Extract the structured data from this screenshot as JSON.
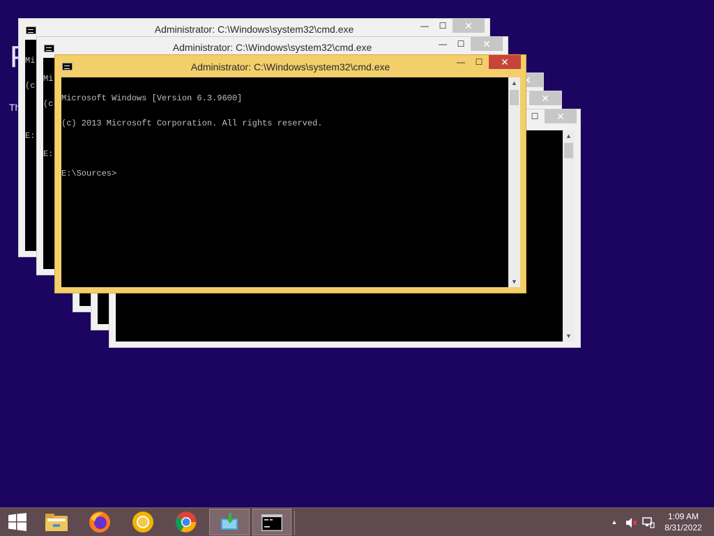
{
  "desktop": {
    "peek_big": "P",
    "peek_small": "Th"
  },
  "windows": {
    "title": "Administrator: C:\\Windows\\system32\\cmd.exe",
    "min_glyph": "—",
    "max_glyph": "☐",
    "close_glyph": "✕",
    "bg1_lines": [
      "Mi",
      "(c",
      "",
      "E:"
    ],
    "bg2_lines": [
      "Mi",
      "(c",
      "",
      "E:"
    ],
    "active_lines": [
      "Microsoft Windows [Version 6.3.9600]",
      "(c) 2013 Microsoft Corporation. All rights reserved.",
      "",
      "E:\\Sources>"
    ]
  },
  "taskbar": {
    "time": "1:09 AM",
    "date": "8/31/2022",
    "apps": [
      "windows-start",
      "file-explorer",
      "firefox",
      "chromium",
      "chrome",
      "setup-media",
      "command-prompt"
    ]
  },
  "colors": {
    "desktop": "#1b0560",
    "active_title": "#f2cf6a",
    "close_active": "#c7443b",
    "taskbar": "#5f4a50"
  }
}
